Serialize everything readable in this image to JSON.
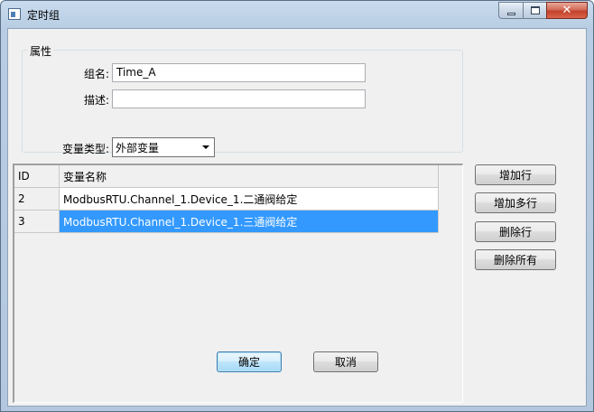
{
  "window": {
    "title": "定时组"
  },
  "properties": {
    "legend": "属性",
    "group_name_label": "组名:",
    "group_name_value": "Time_A",
    "description_label": "描述:",
    "description_value": "",
    "var_type_label": "变量类型:",
    "var_type_selected": "外部变量"
  },
  "table": {
    "headers": {
      "id": "ID",
      "name": "变量名称"
    },
    "rows": [
      {
        "id": "2",
        "name": "ModbusRTU.Channel_1.Device_1.二通阀给定",
        "selected": false
      },
      {
        "id": "3",
        "name": "ModbusRTU.Channel_1.Device_1.三通阀给定",
        "selected": true
      }
    ]
  },
  "side_buttons": {
    "add_row": "增加行",
    "add_multi_rows": "增加多行",
    "delete_row": "删除行",
    "delete_all": "删除所有"
  },
  "footer": {
    "ok": "确定",
    "cancel": "取消"
  },
  "colors": {
    "selection": "#3399ff",
    "title_bg": "#c9dbee",
    "close_button": "#c3412b"
  }
}
